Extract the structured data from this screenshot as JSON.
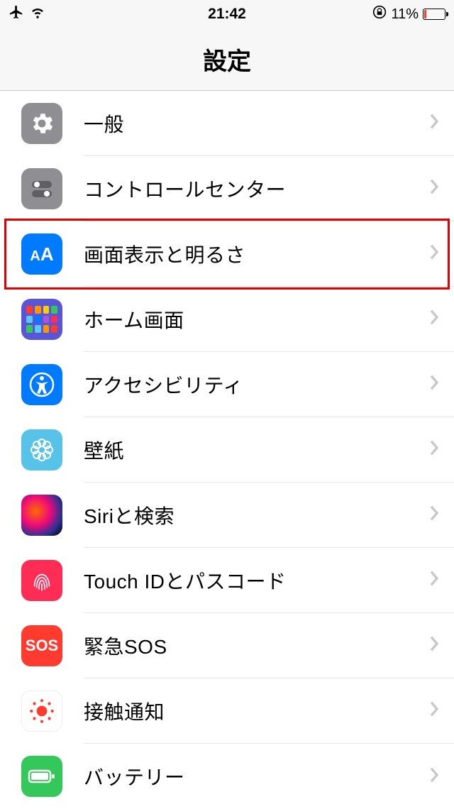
{
  "status": {
    "time": "21:42",
    "battery_percent": "11%"
  },
  "header": {
    "title": "設定"
  },
  "rows": [
    {
      "id": "general",
      "label": "一般"
    },
    {
      "id": "control-center",
      "label": "コントロールセンター"
    },
    {
      "id": "display",
      "label": "画面表示と明るさ",
      "highlighted": true
    },
    {
      "id": "home",
      "label": "ホーム画面"
    },
    {
      "id": "accessibility",
      "label": "アクセシビリティ"
    },
    {
      "id": "wallpaper",
      "label": "壁紙"
    },
    {
      "id": "siri",
      "label": "Siriと検索"
    },
    {
      "id": "touchid",
      "label": "Touch IDとパスコード"
    },
    {
      "id": "sos",
      "label": "緊急SOS"
    },
    {
      "id": "exposure",
      "label": "接触通知"
    },
    {
      "id": "battery",
      "label": "バッテリー"
    }
  ]
}
